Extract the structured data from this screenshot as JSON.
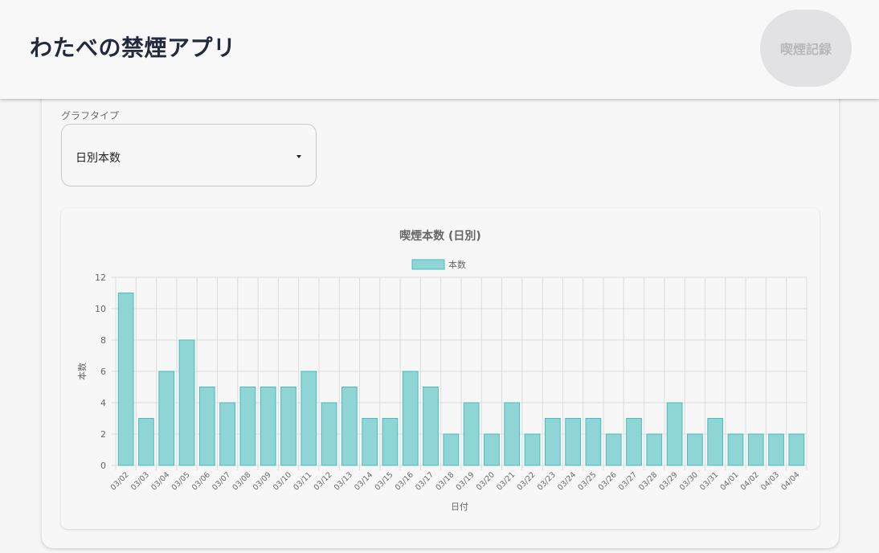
{
  "header": {
    "title": "わたべの禁煙アプリ",
    "record_button_label": "喫煙記録"
  },
  "controls": {
    "graph_type_label": "グラフタイプ",
    "graph_type_value": "日別本数"
  },
  "chart_data": {
    "type": "bar",
    "title": "喫煙本数 (日別)",
    "xlabel": "日付",
    "ylabel": "本数",
    "ylim": [
      0,
      12
    ],
    "yticks": [
      0,
      2,
      4,
      6,
      8,
      10,
      12
    ],
    "grid": true,
    "legend_position": "top",
    "categories": [
      "03/02",
      "03/03",
      "03/04",
      "03/05",
      "03/06",
      "03/07",
      "03/08",
      "03/09",
      "03/10",
      "03/11",
      "03/12",
      "03/13",
      "03/14",
      "03/15",
      "03/16",
      "03/17",
      "03/18",
      "03/19",
      "03/20",
      "03/21",
      "03/22",
      "03/23",
      "03/24",
      "03/25",
      "03/26",
      "03/27",
      "03/28",
      "03/29",
      "03/30",
      "03/31",
      "04/01",
      "04/02",
      "04/03",
      "04/04"
    ],
    "series": [
      {
        "name": "本数",
        "values": [
          11,
          3,
          6,
          8,
          5,
          4,
          5,
          5,
          5,
          6,
          4,
          5,
          3,
          3,
          6,
          5,
          2,
          4,
          2,
          4,
          2,
          3,
          3,
          3,
          2,
          3,
          2,
          4,
          2,
          3,
          2,
          2,
          2,
          2
        ],
        "fill_color": "#8fd5d5",
        "border_color": "#4bbcbc"
      }
    ]
  }
}
